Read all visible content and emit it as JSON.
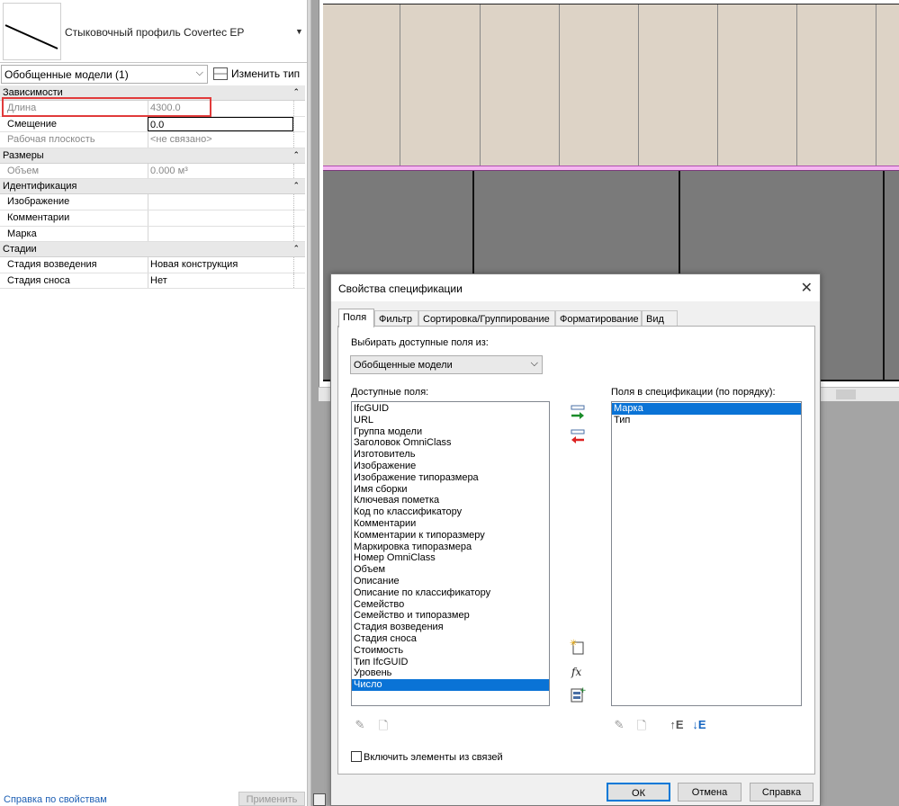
{
  "properties": {
    "type_name": "Стыковочный профиль Covertec EP",
    "filter": "Обобщенные модели (1)",
    "edit_type_label": "Изменить тип",
    "groups": [
      {
        "name": "Зависимости"
      },
      {
        "name": "Размеры"
      },
      {
        "name": "Идентификация"
      },
      {
        "name": "Стадии"
      }
    ],
    "rows": {
      "length_label": "Длина",
      "length_value": "4300.0",
      "offset_label": "Смещение",
      "offset_value": "0.0",
      "workplane_label": "Рабочая плоскость",
      "workplane_value": "<не связано>",
      "volume_label": "Объем",
      "volume_value": "0.000 м³",
      "image_label": "Изображение",
      "image_value": "",
      "comments_label": "Комментарии",
      "comments_value": "",
      "mark_label": "Марка",
      "mark_value": "",
      "phase_created_label": "Стадия возведения",
      "phase_created_value": "Новая конструкция",
      "phase_demolished_label": "Стадия сноса",
      "phase_demolished_value": "Нет"
    },
    "help_link": "Справка по свойствам",
    "apply_label": "Применить"
  },
  "dialog": {
    "title": "Свойства спецификации",
    "tabs": [
      "Поля",
      "Фильтр",
      "Сортировка/Группирование",
      "Форматирование",
      "Вид"
    ],
    "select_from_label": "Выбирать доступные поля из:",
    "category": "Обобщенные модели",
    "available_label": "Доступные поля:",
    "scheduled_label": "Поля в спецификации (по порядку):",
    "available_fields": [
      "IfcGUID",
      "URL",
      "Группа модели",
      "Заголовок OmniClass",
      "Изготовитель",
      "Изображение",
      "Изображение типоразмера",
      "Имя сборки",
      "Ключевая пометка",
      "Код по классификатору",
      "Комментарии",
      "Комментарии к типоразмеру",
      "Маркировка типоразмера",
      "Номер OmniClass",
      "Объем",
      "Описание",
      "Описание по классификатору",
      "Семейство",
      "Семейство и типоразмер",
      "Стадия возведения",
      "Стадия сноса",
      "Стоимость",
      "Тип IfcGUID",
      "Уровень",
      "Число"
    ],
    "available_selected": "Число",
    "scheduled_fields": [
      "Марка",
      "Тип"
    ],
    "scheduled_selected": "Марка",
    "include_links_label": "Включить элементы из связей",
    "buttons": {
      "ok": "ОК",
      "cancel": "Отмена",
      "help": "Справка"
    }
  },
  "colors": {
    "selection": "#0a73d6",
    "highlight_frame": "#e13b3b",
    "panel_fill": "#ddd3c6",
    "pink_line": "#f4b8f0"
  }
}
